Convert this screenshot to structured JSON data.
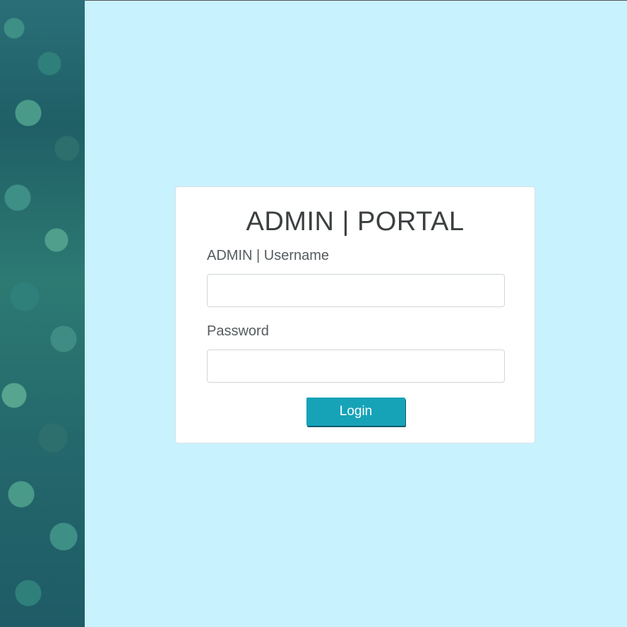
{
  "login": {
    "title": "ADMIN | PORTAL",
    "username_label": "ADMIN | Username",
    "username_value": "",
    "password_label": "Password",
    "password_value": "",
    "login_label": "Login"
  },
  "colors": {
    "background": "#c8f2fd",
    "button": "#16a3b8",
    "card": "#ffffff",
    "text": "#3b3f40"
  }
}
